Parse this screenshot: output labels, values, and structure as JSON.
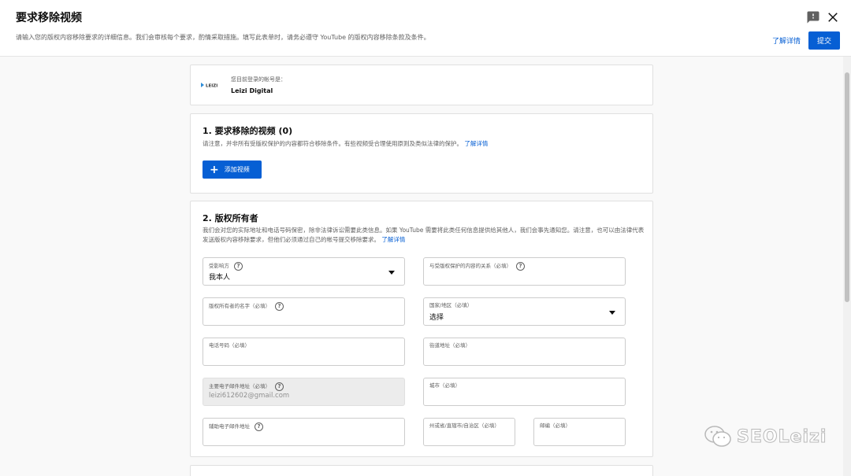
{
  "header": {
    "title": "要求移除视频",
    "subtitle": "请输入您的版权内容移除要求的详细信息。我们会审核每个要求，酌情采取措施。填写此表单时，请务必遵守 YouTube 的版权内容移除条款及条件。",
    "learn_more": "了解详情",
    "submit": "提交"
  },
  "account": {
    "caption": "您目前登录的帐号是：",
    "name": "Leizi Digital",
    "logo_text": "LEIZI"
  },
  "section1": {
    "title": "1. 要求移除的视频 (0)",
    "desc": "请注意，并非所有受版权保护的内容都符合移除条件。有些视频受合理使用原则及类似法律的保护。",
    "learn_more": "了解详情",
    "add_button": "添加视频",
    "add_icon": "+"
  },
  "section2": {
    "title": "2. 版权所有者",
    "desc": "我们会对您的实际地址和电话号码保密，除非法律诉讼需要此类信息。如果 YouTube 需要将此类任何信息提供给其他人，我们会事先通知您。请注意，也可以由法律代表发送版权内容移除要求，但他们必须通过自己的帐号提交移除要求。",
    "learn_more": "了解详情",
    "fields": {
      "affected_party": {
        "label": "受影响方",
        "value": "我本人"
      },
      "relationship": {
        "label": "与受版权保护的内容的关系（必填）"
      },
      "owner_name": {
        "label": "版权所有者的名字（必填）"
      },
      "country": {
        "label": "国家/地区（必填）",
        "value": "选择"
      },
      "phone": {
        "label": "电话号码（必填）"
      },
      "street": {
        "label": "街道地址（必填）"
      },
      "primary_email": {
        "label": "主要电子邮件地址（必填）",
        "value": "leizi612602@gmail.com"
      },
      "city": {
        "label": "城市（必填）"
      },
      "secondary_email": {
        "label": "辅助电子邮件地址"
      },
      "state": {
        "label": "州或省/直辖市/自治区（必填）"
      },
      "zip": {
        "label": "邮编（必填）"
      }
    },
    "help_glyph": "?"
  },
  "watermark": {
    "text": "SEOLeizi"
  }
}
